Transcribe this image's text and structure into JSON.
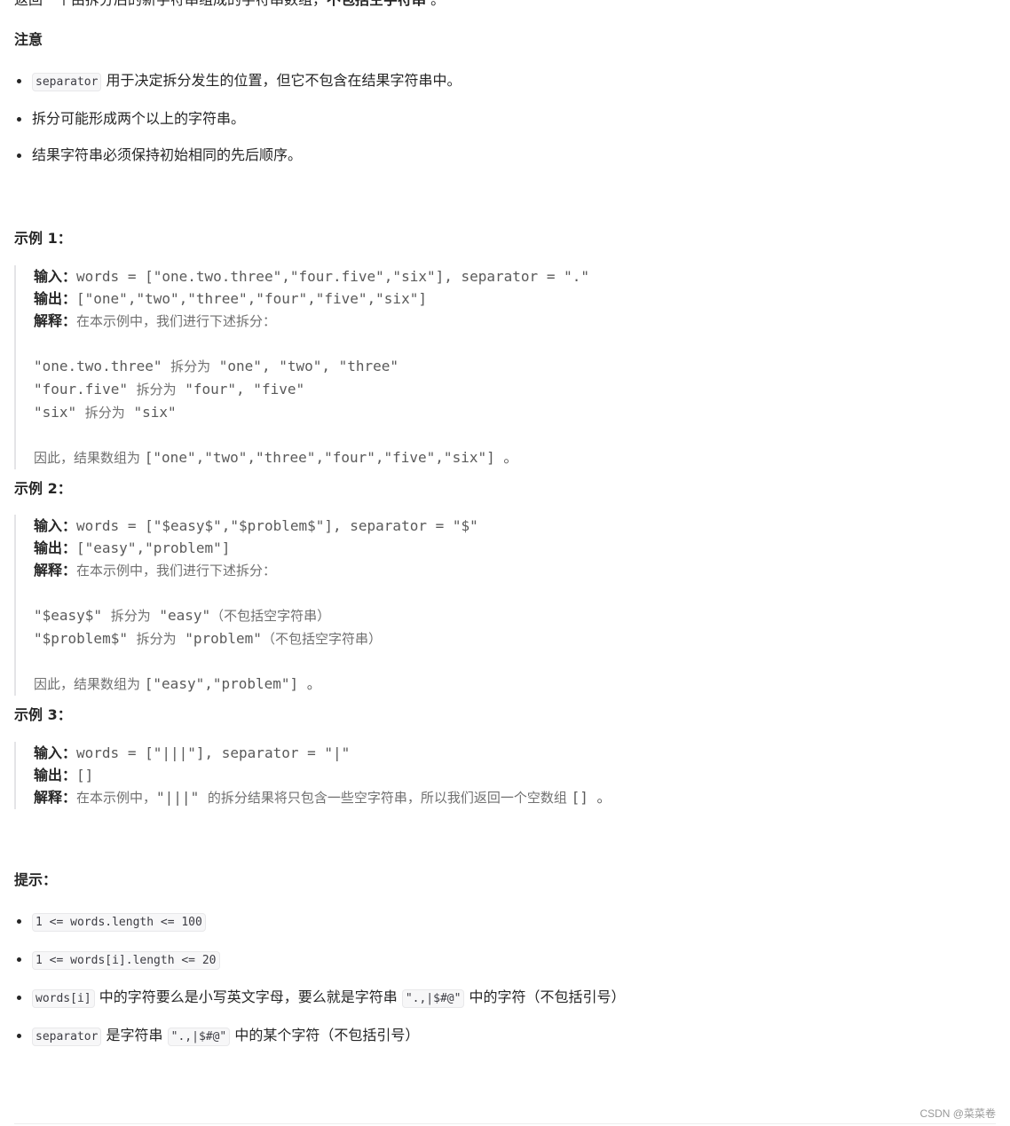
{
  "intro": {
    "text": "返回一个由拆分后的新字符串组成的字符串数组，",
    "bold": "不包括空字符串",
    "tail": " 。"
  },
  "notes": {
    "heading": "注意",
    "items": [
      {
        "code": "separator",
        "text": " 用于决定拆分发生的位置，但它不包含在结果字符串中。"
      },
      {
        "code": "",
        "text": "拆分可能形成两个以上的字符串。"
      },
      {
        "code": "",
        "text": "结果字符串必须保持初始相同的先后顺序。"
      }
    ]
  },
  "labels": {
    "input": "输入：",
    "output": "输出：",
    "explain": "解释："
  },
  "examples": [
    {
      "heading": "示例 1：",
      "input": "words = [\"one.two.three\",\"four.five\",\"six\"], separator = \".\"",
      "output": "[\"one\",\"two\",\"three\",\"four\",\"five\",\"six\"]",
      "explain": "在本示例中，我们进行下述拆分：",
      "lines": [
        {
          "a": "\"one.two.three\" ",
          "b": "拆分为",
          "c": " \"one\", \"two\", \"three\"",
          "d": ""
        },
        {
          "a": "\"four.five\" ",
          "b": "拆分为",
          "c": " \"four\", \"five\"",
          "d": ""
        },
        {
          "a": "\"six\" ",
          "b": "拆分为",
          "c": " \"six\"",
          "d": ""
        }
      ],
      "conclusion_cn": "因此，结果数组为 ",
      "conclusion_code": "[\"one\",\"two\",\"three\",\"four\",\"five\",\"six\"] 。"
    },
    {
      "heading": "示例 2：",
      "input": "words = [\"$easy$\",\"$problem$\"], separator = \"$\"",
      "output": "[\"easy\",\"problem\"]",
      "explain": "在本示例中，我们进行下述拆分：",
      "lines": [
        {
          "a": "\"$easy$\" ",
          "b": "拆分为",
          "c": " \"easy\"",
          "d": "（不包括空字符串）"
        },
        {
          "a": "\"$problem$\" ",
          "b": "拆分为",
          "c": " \"problem\"",
          "d": "（不包括空字符串）"
        }
      ],
      "conclusion_cn": "因此，结果数组为 ",
      "conclusion_code": "[\"easy\",\"problem\"] 。"
    },
    {
      "heading": "示例 3：",
      "input": "words = [\"|||\"], separator = \"|\"",
      "output": "[]",
      "explain_pre": "在本示例中，",
      "explain_code": "\"|||\" ",
      "explain_post": "的拆分结果将只包含一些空字符串，所以我们返回一个空数组 ",
      "explain_tail": "[] 。"
    }
  ],
  "hints": {
    "heading": "提示：",
    "items": [
      {
        "code": "1 <= words.length <= 100",
        "text": "",
        "code2": "",
        "text2": ""
      },
      {
        "code": "1 <= words[i].length <= 20",
        "text": "",
        "code2": "",
        "text2": ""
      },
      {
        "code": "words[i]",
        "text": " 中的字符要么是小写英文字母，要么就是字符串 ",
        "code2": "\".,|$#@\"",
        "text2": " 中的字符（不包括引号）"
      },
      {
        "code": "separator",
        "text": " 是字符串 ",
        "code2": "\".,|$#@\"",
        "text2": " 中的某个字符（不包括引号）"
      }
    ]
  },
  "watermark": "CSDN @菜菜卷"
}
